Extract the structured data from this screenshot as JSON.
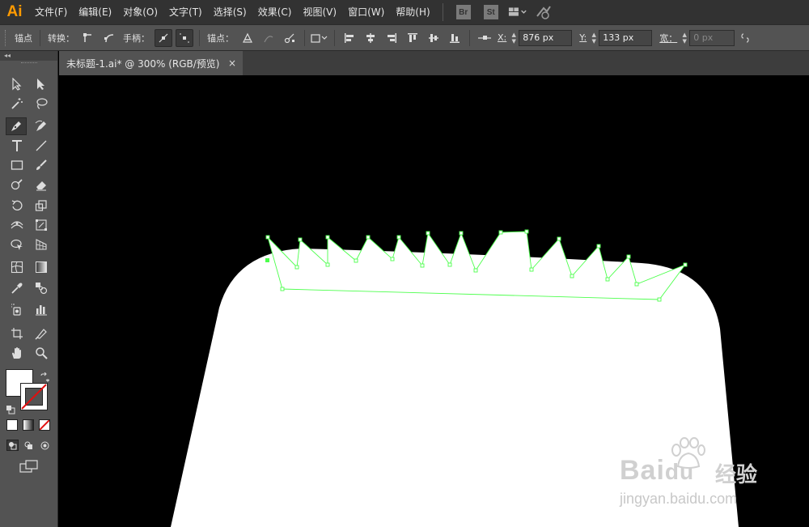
{
  "app": {
    "logo": "Ai"
  },
  "menu": {
    "items": [
      "文件(F)",
      "编辑(E)",
      "对象(O)",
      "文字(T)",
      "选择(S)",
      "效果(C)",
      "视图(V)",
      "窗口(W)",
      "帮助(H)"
    ],
    "badges": [
      "Br",
      "St"
    ]
  },
  "controlbar": {
    "anchor_label": "锚点",
    "convert_label": "转换：",
    "handles_label": "手柄：",
    "anchors_label": "锚点：",
    "x_label": "X:",
    "x_value": "876 px",
    "y_label": "Y:",
    "y_value": "133 px",
    "w_label": "宽：",
    "w_value": "0 px"
  },
  "document": {
    "tab_title": "未标题-1.ai* @ 300% (RGB/预览)",
    "close_glyph": "×"
  },
  "toolbox": {
    "collapse_glyph": "◂◂"
  },
  "colors": {
    "menubar": "#323232",
    "panel": "#535353",
    "canvas": "#000000",
    "artwork_fill": "#ffffff",
    "selection_path": "#4cff4c",
    "logo": "#ff9a00"
  },
  "watermark": {
    "brand": "Bai",
    "brand_suffix": "du",
    "brand_cn": "经验",
    "url": "jingyan.baidu.com"
  }
}
